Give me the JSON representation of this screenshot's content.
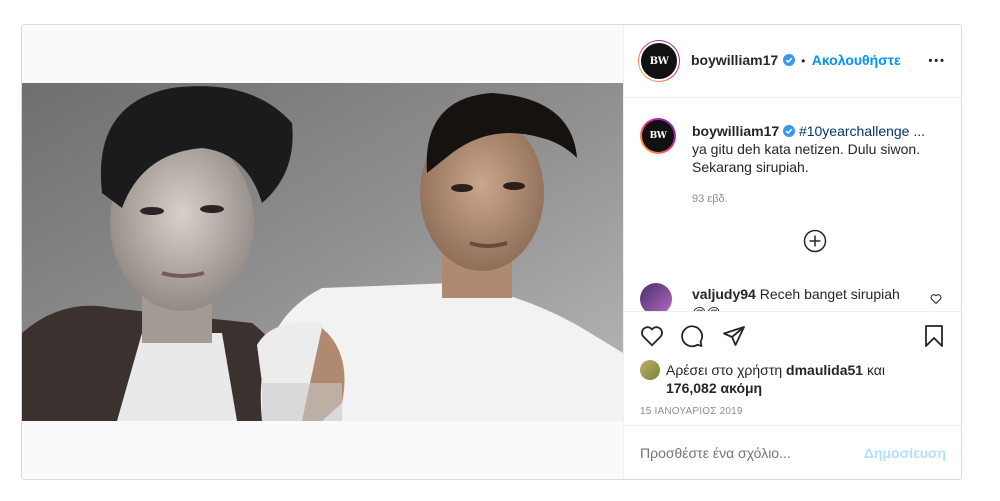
{
  "header": {
    "avatar_logo": "BW",
    "username": "boywilliam17",
    "separator": "•",
    "follow_label": "Ακολουθήστε",
    "more_label": "•••"
  },
  "caption": {
    "username": "boywilliam17",
    "hashtag": "#10yearchallenge",
    "ellipsis": "...",
    "text": "ya gitu deh kata netizen. Dulu siwon. Sekarang sirupiah.",
    "time": "93 εβδ."
  },
  "load_more_icon": "plus-circle-icon",
  "comment": {
    "username": "valjudy94",
    "text": "Receh banget sirupiah",
    "overflow_text": "@@..."
  },
  "actions": {
    "like_icon": "heart-icon",
    "comment_icon": "comment-bubble-icon",
    "share_icon": "paper-plane-icon",
    "save_icon": "bookmark-icon"
  },
  "likes": {
    "prefix": "Αρέσει στο χρήστη",
    "liker": "dmaulida51",
    "and": "και",
    "count": "176,082 ακόμη"
  },
  "date": "15 ΙΑΝΟΥΑΡΙΟΣ 2019",
  "add_comment": {
    "placeholder": "Προσθέστε ένα σχόλιο...",
    "post_label": "Δημοσίευση"
  },
  "colors": {
    "accent": "#0095f6",
    "border": "#dbdbdb",
    "muted": "#8e8e8e",
    "post_disabled": "#b2dffc"
  }
}
